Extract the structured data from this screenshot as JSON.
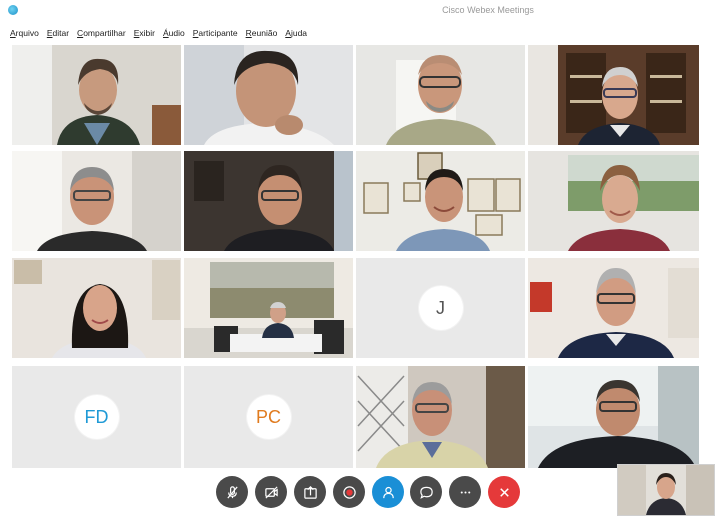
{
  "window": {
    "title": "Cisco Webex Meetings"
  },
  "menu": {
    "items": [
      "Arquivo",
      "Editar",
      "Compartilhar",
      "Exibir",
      "Áudio",
      "Participante",
      "Reunião",
      "Ajuda"
    ]
  },
  "participants": {
    "avatar_j": {
      "initials": "J",
      "color": "#555555"
    },
    "avatar_fd": {
      "initials": "FD",
      "color": "#1f9ad6"
    },
    "avatar_pc": {
      "initials": "PC",
      "color": "#e07b1f"
    }
  },
  "controls": {
    "buttons": [
      {
        "icon": "microphone-muted-icon",
        "color": "#4a4a4a"
      },
      {
        "icon": "video-off-icon",
        "color": "#4a4a4a"
      },
      {
        "icon": "share-icon",
        "color": "#4a4a4a"
      },
      {
        "icon": "record-icon",
        "color": "#4a4a4a"
      },
      {
        "icon": "participants-icon",
        "color": "#1a8fd6"
      },
      {
        "icon": "chat-icon",
        "color": "#4a4a4a"
      },
      {
        "icon": "more-icon",
        "color": "#4a4a4a"
      },
      {
        "icon": "end-call-icon",
        "color": "#e5393a"
      }
    ]
  }
}
